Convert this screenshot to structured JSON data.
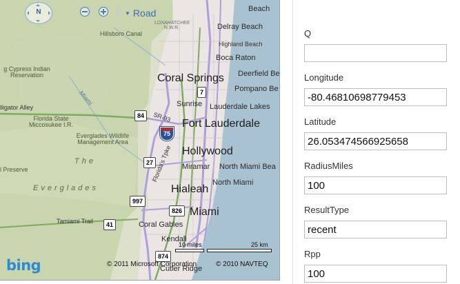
{
  "map": {
    "compass_label": "N",
    "map_style_label": "Road",
    "places": {
      "hillsboro_canal": "Hillsboro Canal",
      "loxahatchee": "LOXAHATCHEE N.W.R.",
      "delray_beach": "Delray Beach",
      "beach_top": "Beach",
      "highland_beach": "Highland Beach",
      "boca_raton": "Boca Raton",
      "deerfield_beach": "Deerfield Be",
      "pompano_beach": "Pompano Be",
      "coral_springs": "Coral Springs",
      "big_cypress": "g Cypress Indian Reservation",
      "miami_canal": "Miami",
      "sunrise": "Sunrise",
      "lauderdale_lakes": "Lauderdale Lakes",
      "alligator_alley": "lligator Alley",
      "sr93": "SR-93",
      "fort_lauderdale": "Fort Lauderdale",
      "florida_state_miccosukee": "Florida State Miccosukee I.R.",
      "everglades_wma": "Everglades Wildlife Management Area",
      "hollywood": "Hollywood",
      "the": "The",
      "miramar": "Miramar",
      "north_miami_beach": "North Miami Bea",
      "preserve": "l Preserve",
      "floridas_turnpike": "Florida's Tpke",
      "north_miami": "North Miami",
      "everglades": "Everglades",
      "hialeah": "Hialeah",
      "miami": "Miami",
      "tamiami_trail": "Tamiami Trail",
      "coral_gables": "Coral Gables",
      "kendall": "Kendall",
      "cutler_ridge": "Cutler Ridge"
    },
    "shields": {
      "i75": "75",
      "r7": "7",
      "r84": "84",
      "r27": "27",
      "r997": "997",
      "r826": "826",
      "r41": "41",
      "r874": "874"
    },
    "scale": {
      "miles": "10 miles",
      "km": "25 km"
    },
    "copyright_ms": "© 2011 Microsoft Corporation",
    "copyright_navteq": "© 2010 NAVTEQ",
    "logo": "bing"
  },
  "form": {
    "fields": [
      {
        "label": "Q",
        "value": ""
      },
      {
        "label": "Longitude",
        "value": "-80.46810698779453"
      },
      {
        "label": "Latitude",
        "value": "26.053474566925658"
      },
      {
        "label": "RadiusMiles",
        "value": "100"
      },
      {
        "label": "ResultType",
        "value": "recent"
      },
      {
        "label": "Rpp",
        "value": "100"
      }
    ]
  },
  "colors": {
    "land_west": "#d8dcc6",
    "land_green": "#c3d2a8",
    "urban": "#ede7e7",
    "water": "#a9c4d3",
    "road_purple": "#b3a6da",
    "road_green": "#7daa5e",
    "accent_blue": "#3f6db3"
  }
}
